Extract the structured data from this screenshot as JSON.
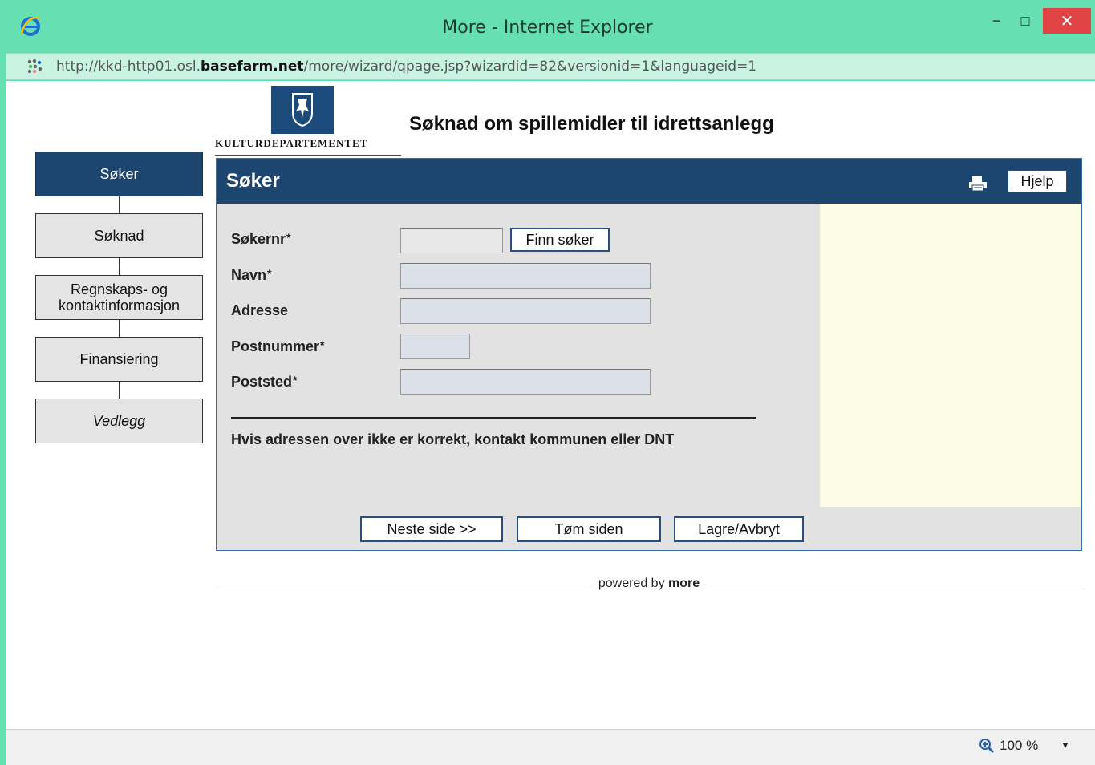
{
  "window": {
    "title": "More - Internet Explorer",
    "minimize_glyph": "−",
    "maximize_glyph": "□",
    "close_glyph": "✕"
  },
  "address_bar": {
    "url_prefix": "http://kkd-http01.osl.",
    "url_domain": "basefarm.net",
    "url_suffix": "/more/wizard/qpage.jsp?wizardid=82&versionid=1&languageid=1"
  },
  "header": {
    "logo_text": "KULTURDEPARTEMENTET",
    "title": "Søknad om spillemidler til idrettsanlegg"
  },
  "sidebar": {
    "items": [
      {
        "label": "Søker"
      },
      {
        "label": "Søknad"
      },
      {
        "label": "Regnskaps- og kontaktinformasjon"
      },
      {
        "label": "Finansiering"
      },
      {
        "label": "Vedlegg"
      }
    ]
  },
  "panel": {
    "title": "Søker",
    "help_label": "Hjelp",
    "fields": {
      "sokernr": {
        "label": "Søkernr",
        "required_mark": "*",
        "value": ""
      },
      "navn": {
        "label": "Navn",
        "required_mark": "*",
        "value": ""
      },
      "adresse": {
        "label": "Adresse",
        "value": ""
      },
      "postnummer": {
        "label": "Postnummer",
        "required_mark": "*",
        "value": ""
      },
      "poststed": {
        "label": "Poststed",
        "required_mark": "*",
        "value": ""
      }
    },
    "find_button": "Finn søker",
    "note": "Hvis adressen over ikke er korrekt, kontakt kommunen eller DNT",
    "buttons": {
      "next": "Neste side >>",
      "clear": "Tøm siden",
      "save_cancel": "Lagre/Avbryt"
    }
  },
  "footer": {
    "powered_by": "powered by",
    "brand": "more"
  },
  "status_bar": {
    "zoom": "100 %",
    "zoom_dropdown": "▼"
  },
  "colors": {
    "titlebar": "#66e0b3",
    "panel_header": "#1c4570",
    "close_button": "#e04343"
  }
}
